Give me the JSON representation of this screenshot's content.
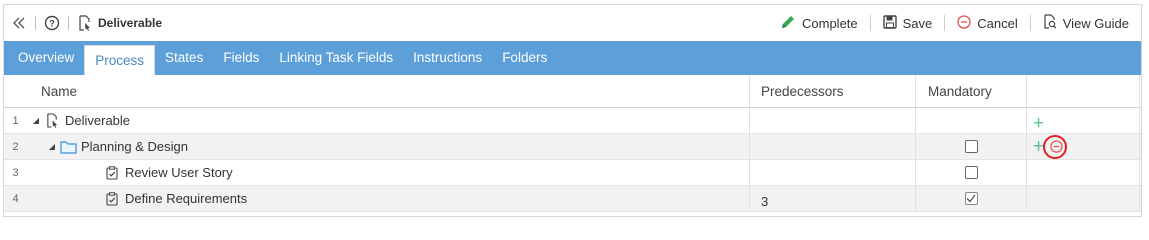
{
  "toolbar": {
    "title": "Deliverable",
    "icons": [
      "collapse-icon",
      "help-icon",
      "deliverable-icon"
    ],
    "buttons": {
      "complete": "Complete",
      "save": "Save",
      "cancel": "Cancel",
      "view_guide": "View Guide"
    }
  },
  "tabs": [
    {
      "label": "Overview",
      "active": false
    },
    {
      "label": "Process",
      "active": true
    },
    {
      "label": "States",
      "active": false
    },
    {
      "label": "Fields",
      "active": false
    },
    {
      "label": "Linking Task Fields",
      "active": false
    },
    {
      "label": "Instructions",
      "active": false
    },
    {
      "label": "Folders",
      "active": false
    }
  ],
  "grid": {
    "columns": {
      "name": "Name",
      "predecessors": "Predecessors",
      "mandatory": "Mandatory"
    },
    "rows": [
      {
        "num": "1",
        "name": "Deliverable",
        "icon": "deliverable-icon",
        "expanded": true,
        "predecessors": "",
        "mandatory": null,
        "actions": [
          "add"
        ]
      },
      {
        "num": "2",
        "name": "Planning & Design",
        "icon": "folder-icon",
        "expanded": true,
        "predecessors": "",
        "mandatory": false,
        "actions": [
          "add",
          "remove"
        ]
      },
      {
        "num": "3",
        "name": "Review User Story",
        "icon": "task-icon",
        "expanded": null,
        "predecessors": "",
        "mandatory": false,
        "actions": []
      },
      {
        "num": "4",
        "name": "Define Requirements",
        "icon": "task-icon",
        "expanded": null,
        "predecessors": "3",
        "mandatory": true,
        "actions": []
      }
    ]
  },
  "colors": {
    "tab_bar": "#5c9fd9",
    "active_tab_text": "#4a88c8",
    "add_green": "#5cc28f",
    "cancel_red": "#e05050",
    "highlight_red": "#e02020",
    "complete_green": "#3aa655"
  }
}
